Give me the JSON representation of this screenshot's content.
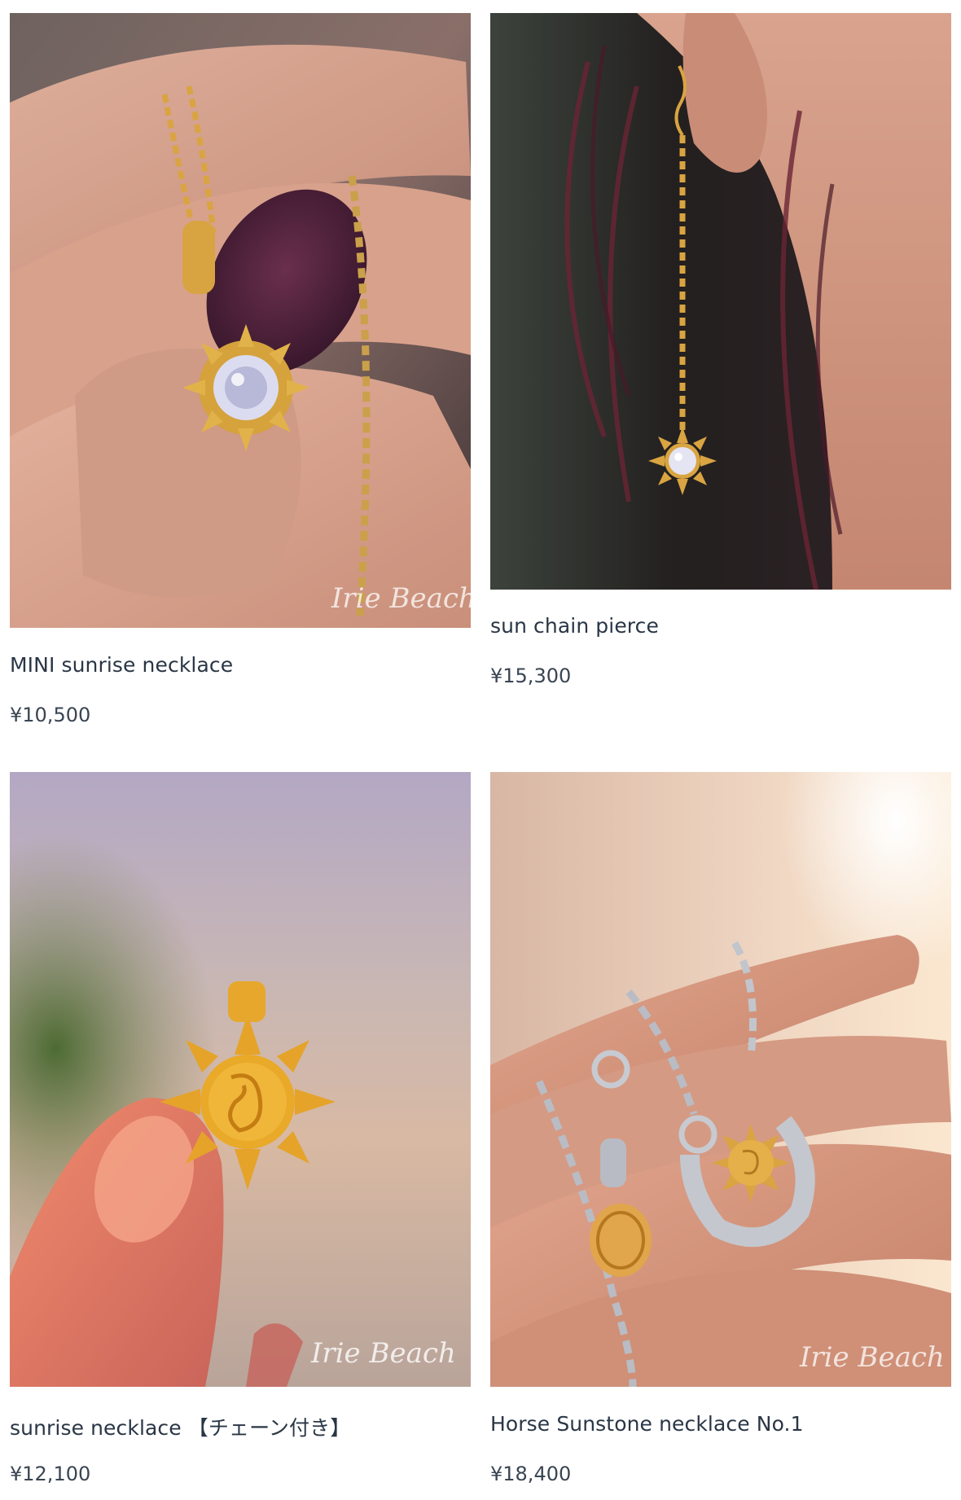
{
  "products": [
    {
      "name": "MINI sunrise necklace",
      "price": "¥10,500",
      "watermark": "Irie Beach"
    },
    {
      "name": "sun chain pierce",
      "price": "¥15,300",
      "watermark": ""
    },
    {
      "name": "sunrise necklace 【チェーン付き】",
      "price": "¥12,100",
      "watermark": "Irie Beach"
    },
    {
      "name": "Horse Sunstone necklace No.1",
      "price": "¥18,400",
      "watermark": "Irie Beach"
    }
  ],
  "icons": {
    "photo_1": "necklace-photo-icon",
    "photo_2": "earring-photo-icon",
    "photo_3": "sun-pendant-photo-icon",
    "photo_4": "horseshoe-necklace-photo-icon"
  },
  "colors": {
    "gold": "#e2a93a",
    "text": "#2a3645",
    "price": "#3a4552"
  }
}
